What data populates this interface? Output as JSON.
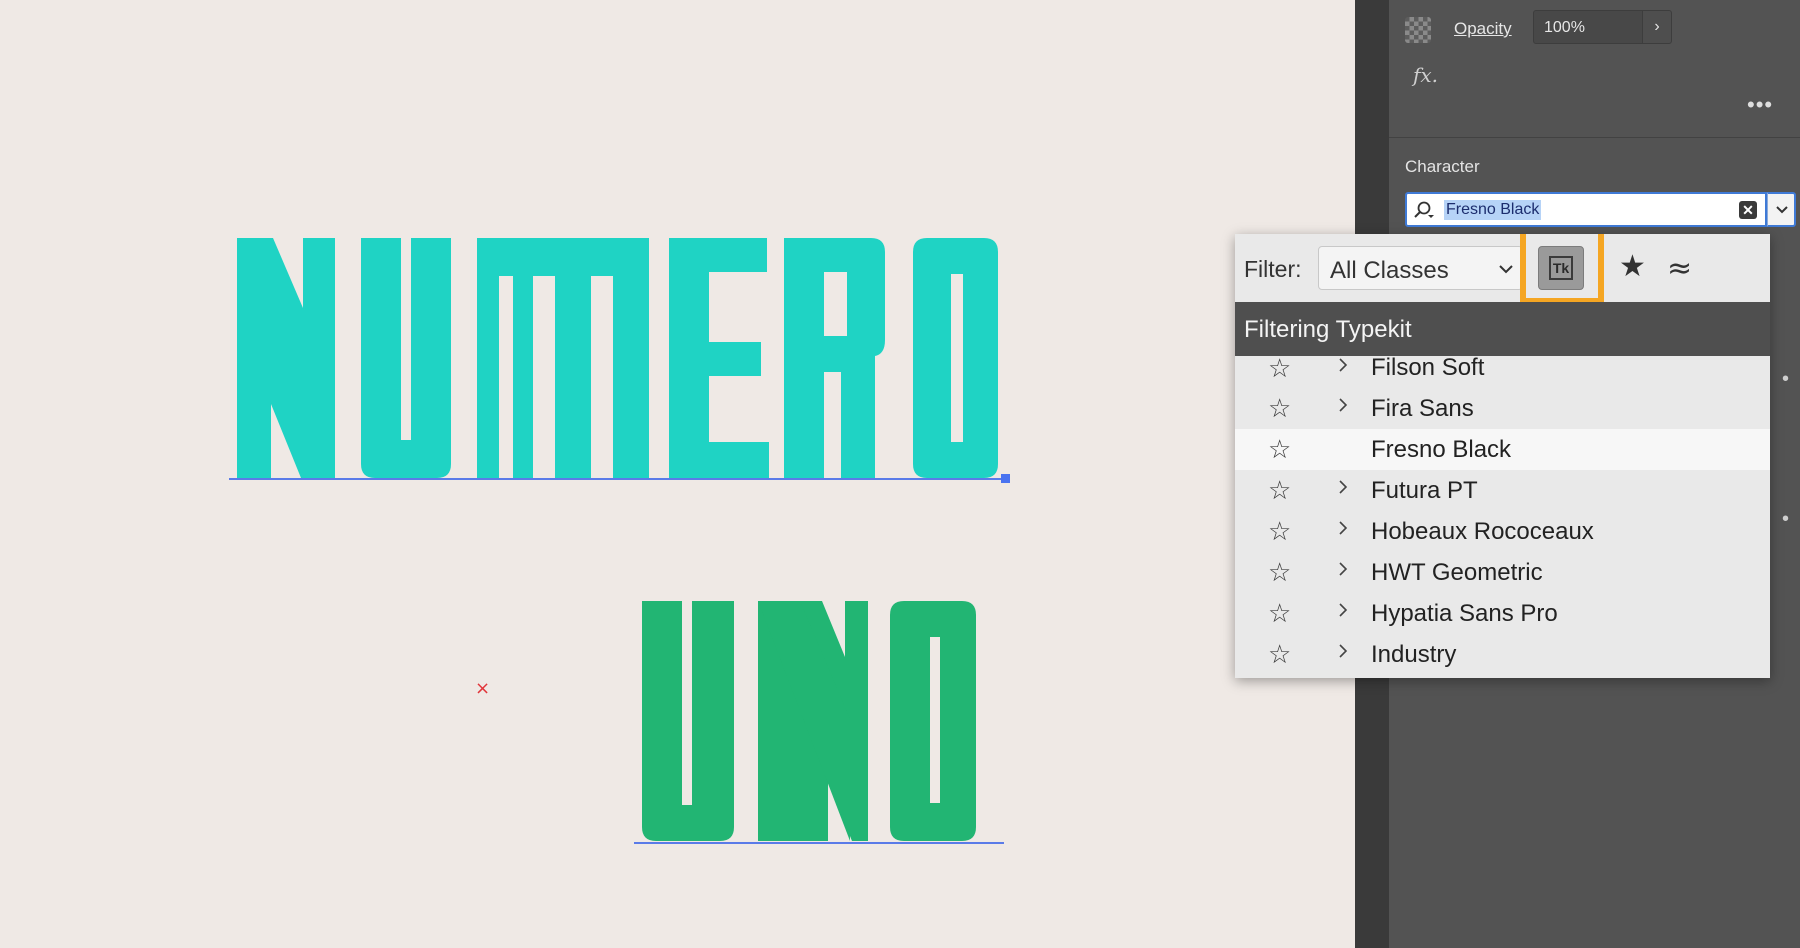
{
  "canvas": {
    "word1": "NUMERO",
    "word2": "UNO",
    "word1_color": "#1fd3c4",
    "word2_color": "#22b573",
    "origin_marker": "×"
  },
  "panel": {
    "opacity_label": "Opacity",
    "opacity_value": "100%",
    "fx_label": "fx.",
    "more_label": "•••",
    "section_title": "Character",
    "font_search_value": "Fresno Black",
    "clear_label": "✕"
  },
  "popup": {
    "filter_label": "Filter:",
    "class_value": "All Classes",
    "typekit_filter_label": "Tk",
    "header": "Filtering Typekit",
    "fonts": [
      {
        "name": "Filson Soft",
        "has_children": true,
        "selected": false
      },
      {
        "name": "Fira Sans",
        "has_children": true,
        "selected": false
      },
      {
        "name": "Fresno Black",
        "has_children": false,
        "selected": true
      },
      {
        "name": "Futura PT",
        "has_children": true,
        "selected": false
      },
      {
        "name": "Hobeaux Rococeaux",
        "has_children": true,
        "selected": false
      },
      {
        "name": "HWT Geometric",
        "has_children": true,
        "selected": false
      },
      {
        "name": "Hypatia Sans Pro",
        "has_children": true,
        "selected": false
      },
      {
        "name": "Industry",
        "has_children": true,
        "selected": false
      }
    ]
  },
  "colors": {
    "highlight": "#f5a623",
    "selection": "#3f7ad6",
    "panel_bg": "#535353",
    "canvas_bg": "#efe9e5"
  }
}
